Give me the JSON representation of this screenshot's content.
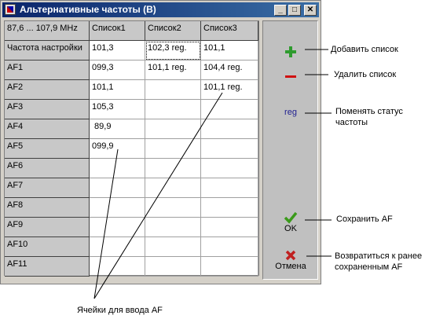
{
  "window": {
    "title": "Альтернативные частоты (B)",
    "controls": [
      "_",
      "□",
      "✕"
    ]
  },
  "grid": {
    "corner": "87,6 ... 107,9 MHz",
    "columns": [
      "Список1",
      "Список2",
      "Список3"
    ],
    "rows": [
      {
        "label": "Частота настройки",
        "values": [
          "101,3",
          "102,3 reg.",
          "101,1"
        ]
      },
      {
        "label": "AF1",
        "values": [
          "099,3",
          "101,1 reg.",
          "104,4 reg."
        ]
      },
      {
        "label": "AF2",
        "values": [
          "101,1",
          "",
          "101,1 reg."
        ]
      },
      {
        "label": "AF3",
        "values": [
          "105,3",
          "",
          ""
        ]
      },
      {
        "label": "AF4",
        "values": [
          " 89,9",
          "",
          ""
        ]
      },
      {
        "label": "AF5",
        "values": [
          "099,9",
          "",
          ""
        ]
      },
      {
        "label": "AF6",
        "values": [
          "",
          "",
          ""
        ]
      },
      {
        "label": "AF7",
        "values": [
          "",
          "",
          ""
        ]
      },
      {
        "label": "AF8",
        "values": [
          "",
          "",
          ""
        ]
      },
      {
        "label": "AF9",
        "values": [
          "",
          "",
          ""
        ]
      },
      {
        "label": "AF10",
        "values": [
          "",
          "",
          ""
        ]
      },
      {
        "label": "AF11",
        "values": [
          "",
          "",
          ""
        ]
      }
    ]
  },
  "side_panel": {
    "add_icon": "plus-icon",
    "remove_icon": "minus-icon",
    "reg_label": "reg",
    "ok_label": "OK",
    "cancel_label": "Отмена"
  },
  "annotations": {
    "add": "Добавить список",
    "remove": "Удалить список",
    "reg_line1": "Поменять статус",
    "reg_line2": "частоты",
    "save": "Сохранить AF",
    "revert_line1": "Возвратиться к ранее",
    "revert_line2": "сохраненным AF",
    "cells": "Ячейки для ввода AF"
  },
  "colors": {
    "title_start": "#0a246a",
    "title_end": "#3a6ea5",
    "add_green": "#2e9b2e",
    "remove_red": "#d01010",
    "ok_green": "#3a9a1a",
    "cancel_red": "#c02020",
    "reg_blue": "#202090"
  }
}
